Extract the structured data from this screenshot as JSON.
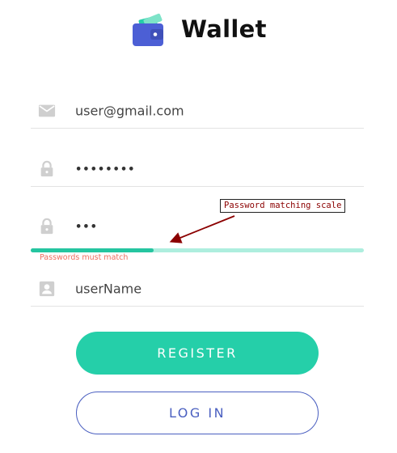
{
  "brand": {
    "title": "Wallet"
  },
  "form": {
    "email": {
      "value": "user@gmail.com",
      "icon": "mail-icon"
    },
    "password": {
      "value": "••••••••",
      "icon": "lock-icon"
    },
    "confirm_password": {
      "value": "•••",
      "icon": "lock-icon"
    },
    "username": {
      "value": "userName",
      "icon": "contact-icon"
    },
    "match_scale": {
      "fill_fraction": 0.37
    },
    "match_error": "Passwords must match"
  },
  "annotation": {
    "label": "Password matching scale"
  },
  "buttons": {
    "register_label": "REGISTER",
    "login_label": "LOG IN"
  },
  "colors": {
    "accent": "#25cfa9",
    "accent_dark": "#25c5a0",
    "scale_track": "#aeeede",
    "secondary": "#4a5fc0",
    "error": "#f06d5f",
    "annotation_text": "#8b0000",
    "logo_wallet": "#4c5fd5"
  }
}
